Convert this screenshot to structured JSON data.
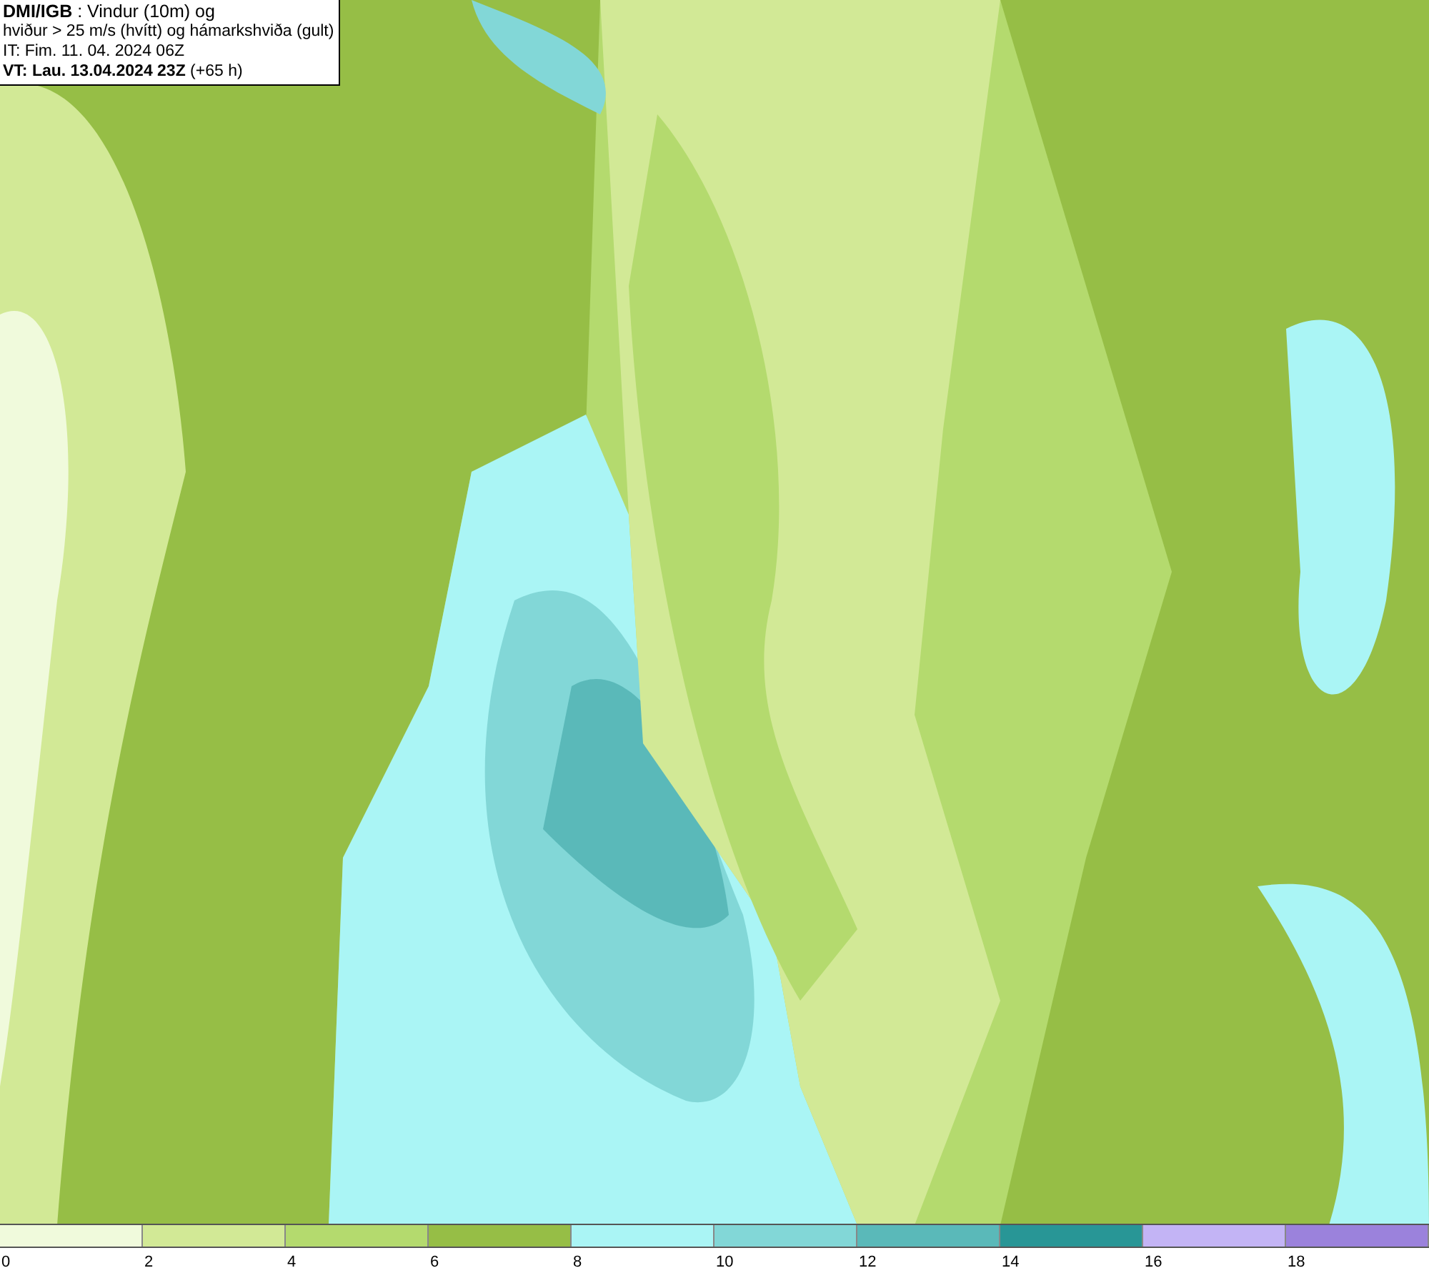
{
  "header": {
    "lines": [
      "**DMI/IGB** : Vindur (10m) og",
      "hviður > 25 m/s (hvítt) og hámarkshviða (gult)",
      "IT: Fim. 11. 04. 2024 06Z",
      "**VT: Lau. 13.04.2024 23Z** (+65 h)"
    ]
  },
  "legend": {
    "segments": [
      {
        "label": "0",
        "color": "#f0fadc"
      },
      {
        "label": "2",
        "color": "#d2e996"
      },
      {
        "label": "4",
        "color": "#b4da6e"
      },
      {
        "label": "6",
        "color": "#96be46"
      },
      {
        "label": "8",
        "color": "#aaf5f5"
      },
      {
        "label": "10",
        "color": "#82d7d7"
      },
      {
        "label": "12",
        "color": "#5ab9b9"
      },
      {
        "label": "14",
        "color": "#289696"
      },
      {
        "label": "16",
        "color": "#c3b4f5"
      },
      {
        "label": "18",
        "color": "#9b82dc"
      }
    ]
  }
}
